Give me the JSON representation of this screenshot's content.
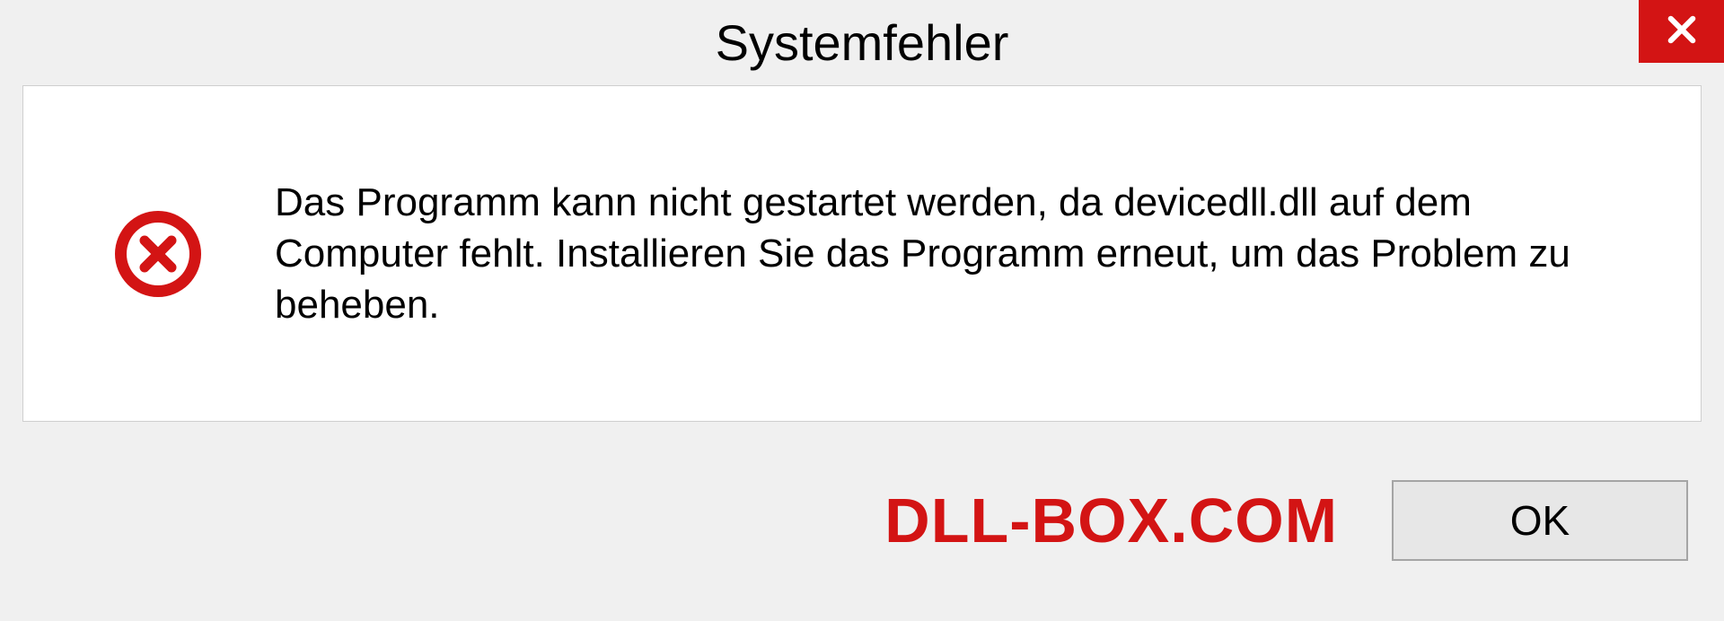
{
  "dialog": {
    "title": "Systemfehler",
    "message": "Das Programm kann nicht gestartet werden, da devicedll.dll auf dem Computer fehlt. Installieren Sie das Programm erneut, um das Problem zu beheben.",
    "ok_label": "OK"
  },
  "watermark": "DLL-BOX.COM",
  "colors": {
    "accent_red": "#d31414",
    "dialog_bg": "#f0f0f0",
    "content_bg": "#ffffff",
    "button_bg": "#e7e7e7"
  }
}
